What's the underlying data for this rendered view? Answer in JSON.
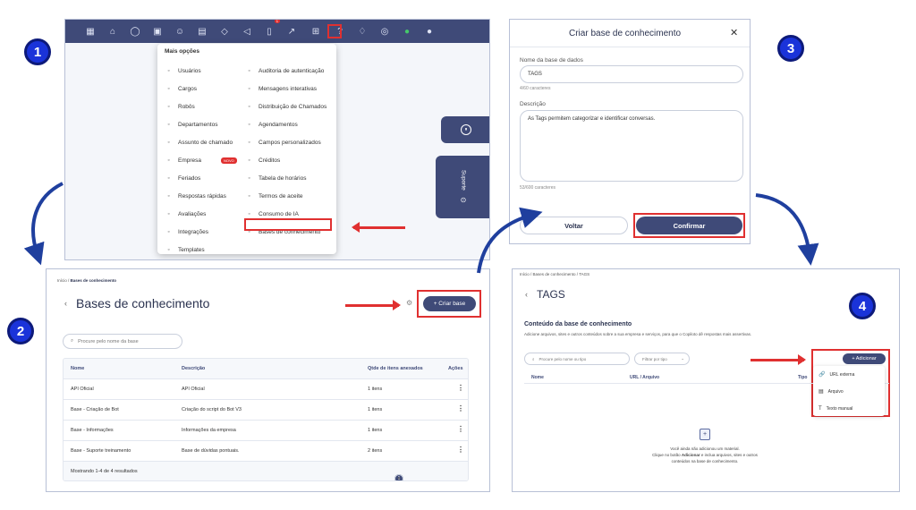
{
  "steps": [
    "1",
    "2",
    "3",
    "4"
  ],
  "panel1": {
    "topbar_badges": [
      "1"
    ],
    "menu_title": "Mais opções",
    "left_items": [
      {
        "icon": "user-icon",
        "label": "Usuários"
      },
      {
        "icon": "briefcase-icon",
        "label": "Cargos"
      },
      {
        "icon": "robot-icon",
        "label": "Robôs"
      },
      {
        "icon": "building-icon",
        "label": "Departamentos"
      },
      {
        "icon": "archive-icon",
        "label": "Assunto de chamado"
      },
      {
        "icon": "company-icon",
        "label": "Empresa",
        "badge": "NOVO"
      },
      {
        "icon": "calendar-icon",
        "label": "Feriados"
      },
      {
        "icon": "lightning-icon",
        "label": "Respostas rápidas"
      },
      {
        "icon": "thumbs-up-icon",
        "label": "Avaliações"
      },
      {
        "icon": "plug-icon",
        "label": "Integrações"
      },
      {
        "icon": "template-icon",
        "label": "Templates"
      }
    ],
    "right_items": [
      {
        "icon": "lock-icon",
        "label": "Auditoria de autenticação"
      },
      {
        "icon": "chat-icon",
        "label": "Mensagens interativas"
      },
      {
        "icon": "distribution-icon",
        "label": "Distribuição de Chamados"
      },
      {
        "icon": "clock-icon",
        "label": "Agendamentos"
      },
      {
        "icon": "list-icon",
        "label": "Campos personalizados"
      },
      {
        "icon": "dollar-icon",
        "label": "Créditos"
      },
      {
        "icon": "table-icon",
        "label": "Tabela de horários"
      },
      {
        "icon": "document-icon",
        "label": "Termos de aceite"
      },
      {
        "icon": "sparkle-icon",
        "label": "Consumo de IA"
      },
      {
        "icon": "database-icon",
        "label": "Bases de conhecimento"
      }
    ],
    "suporte_label": "Suporte"
  },
  "panel2": {
    "breadcrumb_home": "Início / ",
    "breadcrumb_current": "Bases de conhecimento",
    "title": "Bases de conhecimento",
    "create_button": "+ Criar base",
    "search_placeholder": "Procure pelo nome da base",
    "columns": [
      "Nome",
      "Descrição",
      "Qtde de itens anexados",
      "Ações"
    ],
    "rows": [
      {
        "name": "API Oficial",
        "description": "API Oficial",
        "items": "1 itens"
      },
      {
        "name": "Base - Criação de Bot",
        "description": "Criação do script do Bot V3",
        "items": "1 itens"
      },
      {
        "name": "Base - Informações",
        "description": "Informações da empresa",
        "items": "1 itens"
      },
      {
        "name": "Base - Suporte treinamento",
        "description": "Base de dúvidas pontuais.",
        "items": "2 itens"
      }
    ],
    "footer_text": "Mostrando 1-4 de 4 resultados",
    "current_page": "1"
  },
  "panel3": {
    "title": "Criar base de conhecimento",
    "name_label": "Nome da base de dados",
    "name_value": "TAGS",
    "name_counter": "4/60 caracteres",
    "desc_label": "Descrição",
    "desc_value": "As Tags permitem categorizar e identificar conversas.",
    "desc_counter": "53/600 caracteres",
    "back_button": "Voltar",
    "confirm_button": "Confirmar"
  },
  "panel4": {
    "breadcrumb": "Início / Bases de conhecimento / TAGS",
    "title": "TAGS",
    "section_title": "Conteúdo da base de conhecimento",
    "section_desc": "Adicione arquivos, sites e outros conteúdos sobre a sua empresa e serviços, para que o Copiloto dê respostas mais assertivas.",
    "search_placeholder": "Procure pelo nome ou tipo",
    "filter_label": "Filtrar por tipo",
    "add_button": "+ Adicionar",
    "columns": [
      "Nome",
      "URL / Arquivo",
      "Tipo"
    ],
    "dropdown": [
      {
        "icon": "link-icon",
        "label": "URL externa"
      },
      {
        "icon": "file-icon",
        "label": "Arquivo"
      },
      {
        "icon": "text-icon",
        "label": "Texto manual"
      }
    ],
    "empty_line1": "Você ainda não adicionou um material.",
    "empty_line2_pre": "Clique no botão ",
    "empty_line2_bold": "Adicionar",
    "empty_line2_post": " e inclua arquivos, sites e outros",
    "empty_line3": "conteúdos na base de conhecimento."
  }
}
